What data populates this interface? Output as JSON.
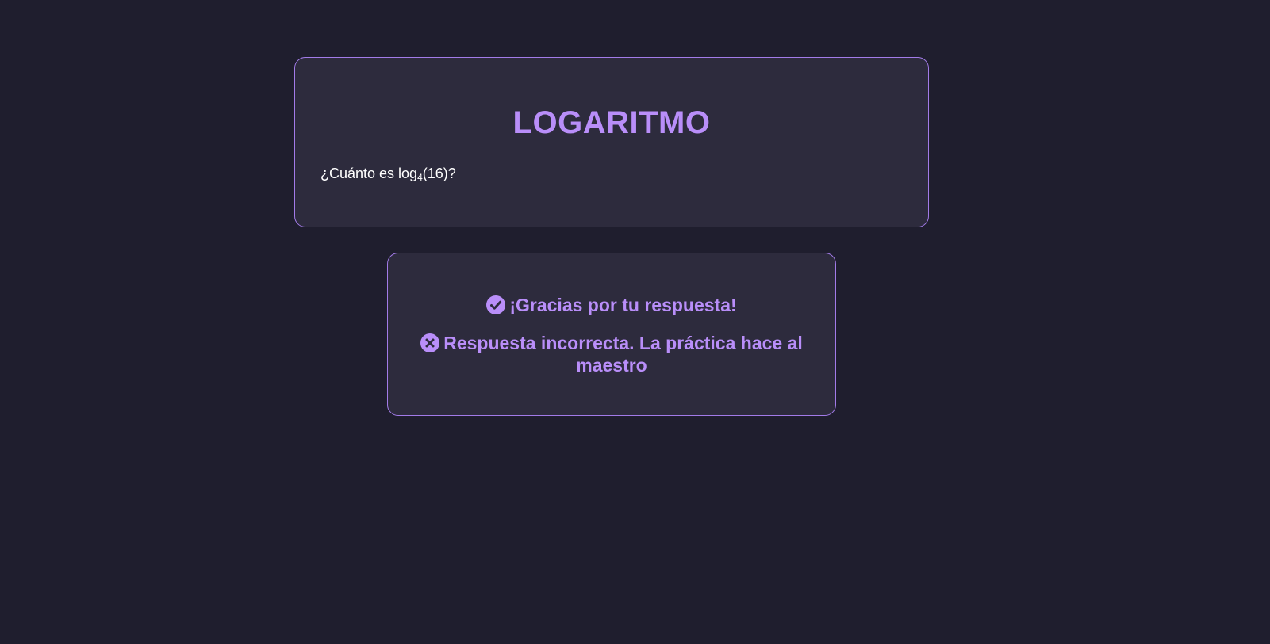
{
  "question_card": {
    "title": "LOGARITMO",
    "prompt_prefix": "¿Cuánto es log",
    "prompt_base": "4",
    "prompt_suffix": "(16)?"
  },
  "feedback_card": {
    "thanks_icon": "check-circle-icon",
    "thanks_text": "¡Gracias por tu respuesta!",
    "result_icon": "x-circle-icon",
    "result_text": "Respuesta incorrecta. La práctica hace al maestro"
  },
  "colors": {
    "background": "#1f1e2e",
    "card_background": "#2d2b3d",
    "accent": "#b98ef9",
    "border": "#a27be8",
    "text": "#ffffff"
  }
}
